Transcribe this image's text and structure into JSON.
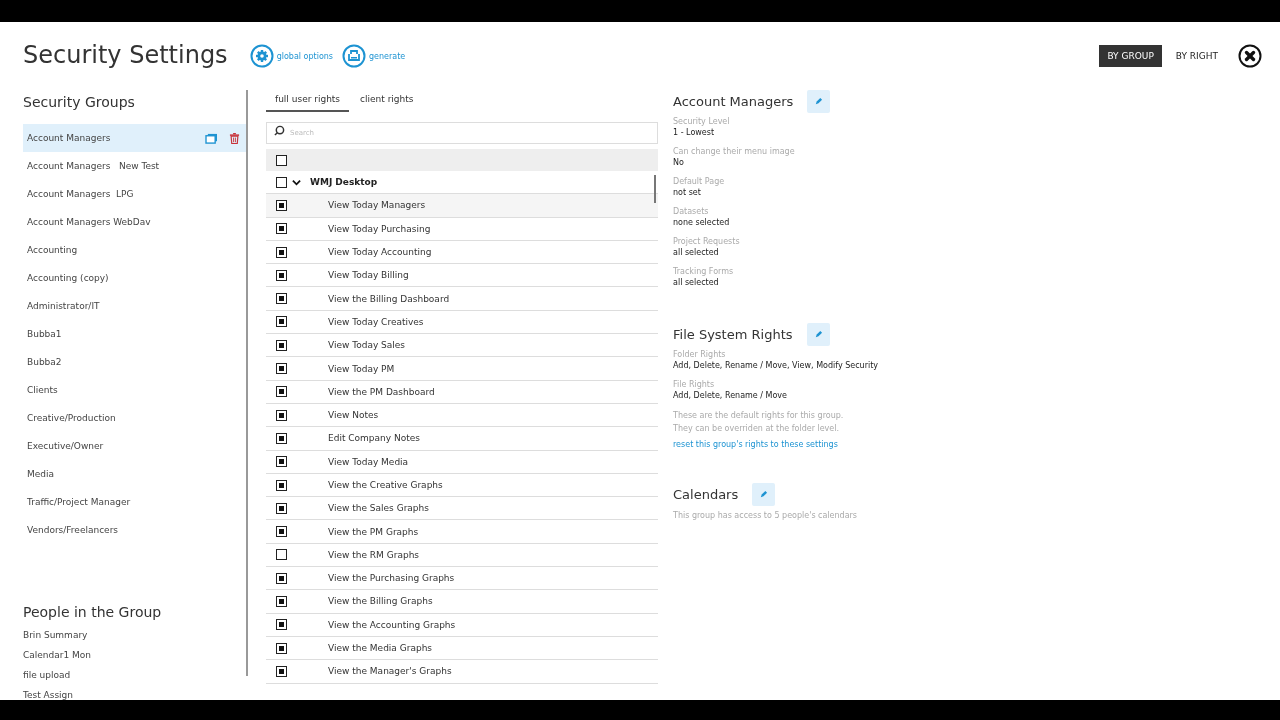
{
  "header": {
    "title": "Security Settings",
    "actions": [
      {
        "kind": "gear",
        "label": "global options"
      },
      {
        "kind": "print",
        "label": "generate"
      }
    ],
    "view_toggle": [
      {
        "label": "BY GROUP",
        "selected": true
      },
      {
        "label": "BY RIGHT",
        "selected": false
      }
    ]
  },
  "security_groups": {
    "title": "Security Groups",
    "items": [
      {
        "label": "Account Managers",
        "selected": true
      },
      {
        "label": "Account Managers   New Test",
        "selected": false
      },
      {
        "label": "Account Managers  LPG",
        "selected": false
      },
      {
        "label": "Account Managers WebDav",
        "selected": false
      },
      {
        "label": "Accounting",
        "selected": false
      },
      {
        "label": "Accounting (copy)",
        "selected": false
      },
      {
        "label": "Administrator/IT",
        "selected": false
      },
      {
        "label": "Bubba1",
        "selected": false
      },
      {
        "label": "Bubba2",
        "selected": false
      },
      {
        "label": "Clients",
        "selected": false
      },
      {
        "label": "Creative/Production",
        "selected": false
      },
      {
        "label": "Executive/Owner",
        "selected": false
      },
      {
        "label": "Media",
        "selected": false
      },
      {
        "label": "Traffic/Project Manager",
        "selected": false
      },
      {
        "label": "Vendors/Freelancers",
        "selected": false
      }
    ]
  },
  "people": {
    "title": "People in the Group",
    "items": [
      "Brin Summary",
      "Calendar1 Mon",
      "file upload",
      "Test Assign"
    ]
  },
  "rights": {
    "tabs": [
      {
        "label": "full user rights",
        "selected": true
      },
      {
        "label": "client rights",
        "selected": false
      }
    ],
    "search": {
      "placeholder": "Search"
    },
    "select_all": {
      "checked": false
    },
    "groups": [
      {
        "label": "WMJ Desktop",
        "checked": false,
        "expanded": true,
        "children": [
          {
            "label": "View Today Managers",
            "checked": true
          },
          {
            "label": "View Today Purchasing",
            "checked": true
          },
          {
            "label": "View Today Accounting",
            "checked": true
          },
          {
            "label": "View Today Billing",
            "checked": true
          },
          {
            "label": "View the Billing Dashboard",
            "checked": true
          },
          {
            "label": "View Today Creatives",
            "checked": true
          },
          {
            "label": "View Today Sales",
            "checked": true
          },
          {
            "label": "View Today PM",
            "checked": true
          },
          {
            "label": "View the PM Dashboard",
            "checked": true
          },
          {
            "label": "View Notes",
            "checked": true
          },
          {
            "label": "Edit Company Notes",
            "checked": true
          },
          {
            "label": "View Today Media",
            "checked": true
          },
          {
            "label": "View the Creative Graphs",
            "checked": true
          },
          {
            "label": "View the Sales Graphs",
            "checked": true
          },
          {
            "label": "View the PM Graphs",
            "checked": true
          },
          {
            "label": "View the RM Graphs",
            "checked": false
          },
          {
            "label": "View the Purchasing Graphs",
            "checked": true
          },
          {
            "label": "View the Billing Graphs",
            "checked": true
          },
          {
            "label": "View the Accounting Graphs",
            "checked": true
          },
          {
            "label": "View the Media Graphs",
            "checked": true
          },
          {
            "label": "View the Manager's Graphs",
            "checked": true
          }
        ]
      }
    ]
  },
  "details": [
    {
      "title": "Account Managers",
      "fields": [
        {
          "label": "Security Level",
          "value": "1 - Lowest"
        },
        {
          "label": "Can change their menu image",
          "value": "No"
        },
        {
          "label": "Default Page",
          "value": "not set"
        },
        {
          "label": "Datasets",
          "value": "none selected"
        },
        {
          "label": "Project Requests",
          "value": "all selected"
        },
        {
          "label": "Tracking Forms",
          "value": "all selected"
        }
      ]
    },
    {
      "title": "File System Rights",
      "fields": [
        {
          "label": "Folder Rights",
          "value": "Add, Delete, Rename / Move, View, Modify Security"
        },
        {
          "label": "File Rights",
          "value": "Add, Delete, Rename / Move"
        }
      ],
      "note": [
        "These are the default rights for this group.",
        "They can be overriden at the folder level."
      ],
      "link": "reset this group's rights to these settings"
    },
    {
      "title": "Calendars",
      "note": [
        "This group has access to 5 people's calendars"
      ]
    }
  ]
}
